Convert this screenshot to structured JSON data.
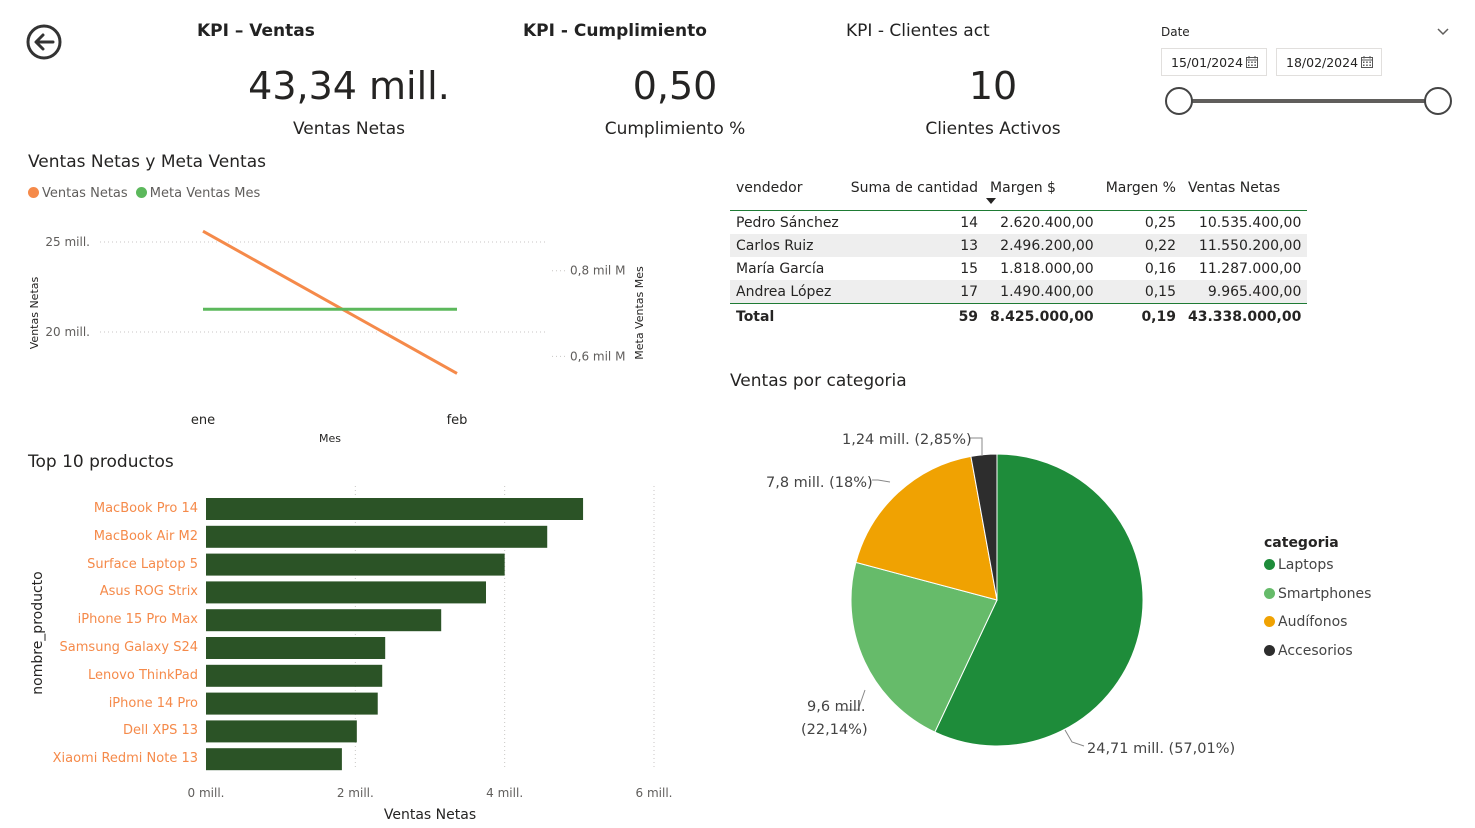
{
  "nav": {
    "back_icon": "back-arrow-icon"
  },
  "kpis": [
    {
      "title": "KPI – Ventas",
      "value": "43,34 mill.",
      "label": "Ventas Netas"
    },
    {
      "title": "KPI - Cumplimiento",
      "value": "0,50",
      "label": "Cumplimiento %"
    },
    {
      "title": "KPI - Clientes act",
      "value": "10",
      "label": "Clientes Activos"
    }
  ],
  "date_slicer": {
    "label": "Date",
    "start": "15/01/2024",
    "end": "18/02/2024",
    "range_fraction": [
      0,
      1
    ]
  },
  "line_chart": {
    "title": "Ventas Netas y Meta Ventas",
    "legend": [
      {
        "name": "Ventas Netas",
        "color": "#f58a4a"
      },
      {
        "name": "Meta Ventas Mes",
        "color": "#5cb85c"
      }
    ]
  },
  "matrix": {
    "headers": [
      "vendedor",
      "Suma de cantidad",
      "Margen $",
      "Margen %",
      "Ventas Netas"
    ],
    "rows": [
      [
        "Pedro Sánchez",
        "14",
        "2.620.400,00",
        "0,25",
        "10.535.400,00"
      ],
      [
        "Carlos Ruiz",
        "13",
        "2.496.200,00",
        "0,22",
        "11.550.200,00"
      ],
      [
        "María García",
        "15",
        "1.818.000,00",
        "0,16",
        "11.287.000,00"
      ],
      [
        "Andrea López",
        "17",
        "1.490.400,00",
        "0,15",
        "9.965.400,00"
      ]
    ],
    "total": [
      "Total",
      "59",
      "8.425.000,00",
      "0,19",
      "43.338.000,00"
    ],
    "accent": "#1e7b34"
  },
  "bar_chart": {
    "title": "Top 10 productos"
  },
  "pie_chart": {
    "title": "Ventas por categoria",
    "legend_title": "categoria",
    "data_labels": [
      "24,71 mill. (57,01%)",
      "9,6 mill.",
      "(22,14%)",
      "7,8 mill. (18%)",
      "1,24 mill. (2,85%)"
    ]
  },
  "chart_data": [
    {
      "type": "line",
      "title": "Ventas Netas y Meta Ventas",
      "xlabel": "Mes",
      "ylabel": "Ventas Netas",
      "y2label": "Meta Ventas Mes",
      "categories": [
        "ene",
        "feb"
      ],
      "ylim": [
        16.5,
        26.5
      ],
      "yticks": [
        {
          "value": 20,
          "label": "20 mill."
        },
        {
          "value": 25,
          "label": "25 mill."
        }
      ],
      "y2lim": [
        0.51,
        0.93
      ],
      "y2ticks": [
        {
          "value": 0.6,
          "label": "0,6 mil M"
        },
        {
          "value": 0.8,
          "label": "0,8 mil M"
        }
      ],
      "series": [
        {
          "name": "Ventas Netas",
          "axis": "left",
          "color": "#f58a4a",
          "values": [
            25.6,
            17.7
          ]
        },
        {
          "name": "Meta Ventas Mes",
          "axis": "right",
          "color": "#5cb85c",
          "values": [
            0.71,
            0.71
          ]
        }
      ],
      "grid": true,
      "legend_position": "top-left"
    },
    {
      "type": "bar",
      "orientation": "horizontal",
      "title": "Top 10 productos",
      "xlabel": "Ventas Netas",
      "ylabel": "nombre_producto",
      "categories": [
        "MacBook Pro 14",
        "MacBook Air M2",
        "Surface Laptop 5",
        "Asus ROG Strix",
        "iPhone 15 Pro Max",
        "Samsung Galaxy S24",
        "Lenovo ThinkPad",
        "iPhone 14 Pro",
        "Dell XPS 13",
        "Xiaomi Redmi Note 13"
      ],
      "values": [
        5.05,
        4.57,
        4.0,
        3.75,
        3.15,
        2.4,
        2.36,
        2.3,
        2.02,
        1.82
      ],
      "xlim": [
        0,
        6
      ],
      "xticks": [
        {
          "value": 0,
          "label": "0 mill."
        },
        {
          "value": 2,
          "label": "2 mill."
        },
        {
          "value": 4,
          "label": "4 mill."
        },
        {
          "value": 6,
          "label": "6 mill."
        }
      ],
      "color": "#2b5326",
      "grid": true
    },
    {
      "type": "pie",
      "title": "Ventas por categoria",
      "slices": [
        {
          "name": "Laptops",
          "value": 24.71,
          "percent": 57.01,
          "color": "#1e8c3a"
        },
        {
          "name": "Smartphones",
          "value": 9.6,
          "percent": 22.14,
          "color": "#66bb6a"
        },
        {
          "name": "Audífonos",
          "value": 7.8,
          "percent": 18,
          "color": "#f0a202"
        },
        {
          "name": "Accesorios",
          "value": 1.24,
          "percent": 2.85,
          "color": "#2d2d2d"
        }
      ],
      "legend_position": "right"
    }
  ]
}
